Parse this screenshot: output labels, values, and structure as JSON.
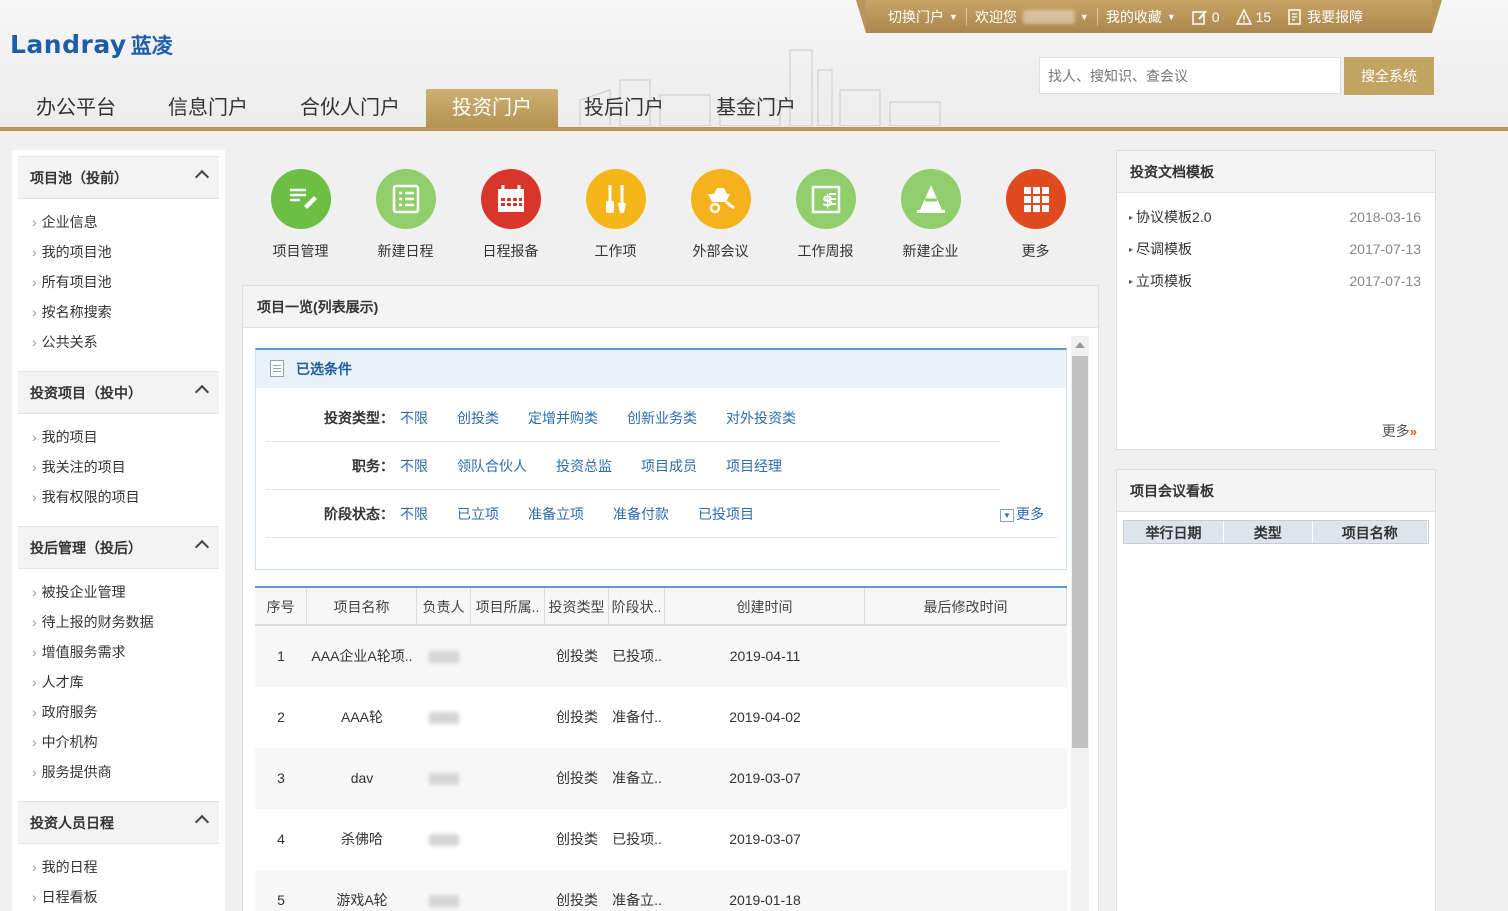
{
  "brand": {
    "name_en": "Landray",
    "name_cn": "蓝凌"
  },
  "topbar": {
    "switch_portal": "切换门户",
    "welcome": "欢迎您",
    "favorites": "我的收藏",
    "todo_count": "0",
    "alert_count": "15",
    "report_issue": "我要报障"
  },
  "search": {
    "placeholder": "找人、搜知识、查会议",
    "button": "搜全系统"
  },
  "nav": [
    {
      "label": "办公平台",
      "active": false
    },
    {
      "label": "信息门户",
      "active": false
    },
    {
      "label": "合伙人门户",
      "active": false
    },
    {
      "label": "投资门户",
      "active": true
    },
    {
      "label": "投后门户",
      "active": false
    },
    {
      "label": "基金门户",
      "active": false
    }
  ],
  "sidebar": [
    {
      "title": "项目池（投前）",
      "items": [
        "企业信息",
        "我的项目池",
        "所有项目池",
        "按名称搜索",
        "公共关系"
      ]
    },
    {
      "title": "投资项目（投中）",
      "items": [
        "我的项目",
        "我关注的项目",
        "我有权限的项目"
      ]
    },
    {
      "title": "投后管理（投后）",
      "items": [
        "被投企业管理",
        "待上报的财务数据",
        "增值服务需求",
        "人才库",
        "政府服务",
        "中介机构",
        "服务提供商"
      ]
    },
    {
      "title": "投资人员日程",
      "items": [
        "我的日程",
        "日程看板"
      ]
    }
  ],
  "quick_actions": [
    {
      "label": "项目管理",
      "icon": "pen-note-icon",
      "color": "#6cbf45"
    },
    {
      "label": "新建日程",
      "icon": "list-icon",
      "color": "#8fce6b"
    },
    {
      "label": "日程报备",
      "icon": "calendar-icon",
      "color": "#d9352a"
    },
    {
      "label": "工作项",
      "icon": "tools-icon",
      "color": "#f5b61a"
    },
    {
      "label": "外部会议",
      "icon": "wheelbarrow-icon",
      "color": "#f4b31c"
    },
    {
      "label": "工作周报",
      "icon": "dollar-doc-icon",
      "color": "#8fce6b"
    },
    {
      "label": "新建企业",
      "icon": "cone-icon",
      "color": "#8fce6b"
    },
    {
      "label": "更多",
      "icon": "grid-icon",
      "color": "#e04a1f"
    }
  ],
  "project_panel": {
    "title": "项目一览(列表展示)",
    "conditions_title": "已选条件",
    "filters": [
      {
        "label": "投资类型：",
        "options": [
          "不限",
          "创投类",
          "定增并购类",
          "创新业务类",
          "对外投资类"
        ]
      },
      {
        "label": "职务：",
        "options": [
          "不限",
          "领队合伙人",
          "投资总监",
          "项目成员",
          "项目经理"
        ]
      },
      {
        "label": "阶段状态：",
        "options": [
          "不限",
          "已立项",
          "准备立项",
          "准备付款",
          "已投项目"
        ]
      }
    ],
    "more_label": "更多",
    "columns": [
      "序号",
      "项目名称",
      "负责人",
      "项目所属..",
      "投资类型",
      "阶段状..",
      "创建时间",
      "最后修改时间"
    ],
    "rows": [
      {
        "no": "1",
        "name": "AAA企业A轮项..",
        "type": "创投类",
        "stage": "已投项..",
        "created": "2019-04-11",
        "modified": ""
      },
      {
        "no": "2",
        "name": "AAA轮",
        "type": "创投类",
        "stage": "准备付..",
        "created": "2019-04-02",
        "modified": ""
      },
      {
        "no": "3",
        "name": "dav",
        "type": "创投类",
        "stage": "准备立..",
        "created": "2019-03-07",
        "modified": ""
      },
      {
        "no": "4",
        "name": "杀佛哈",
        "type": "创投类",
        "stage": "已投项..",
        "created": "2019-03-07",
        "modified": ""
      },
      {
        "no": "5",
        "name": "游戏A轮",
        "type": "创投类",
        "stage": "准备立..",
        "created": "2019-01-18",
        "modified": ""
      }
    ]
  },
  "doc_templates": {
    "title": "投资文档模板",
    "items": [
      {
        "name": "协议模板2.0",
        "date": "2018-03-16"
      },
      {
        "name": "尽调模板",
        "date": "2017-07-13"
      },
      {
        "name": "立项模板",
        "date": "2017-07-13"
      }
    ],
    "more": "更多"
  },
  "meeting_board": {
    "title": "项目会议看板",
    "columns": [
      "举行日期",
      "类型",
      "项目名称"
    ]
  },
  "colors": {
    "gold": "#b8955a",
    "link": "#2b6cb0",
    "accent_blue": "#5a9bd5"
  }
}
